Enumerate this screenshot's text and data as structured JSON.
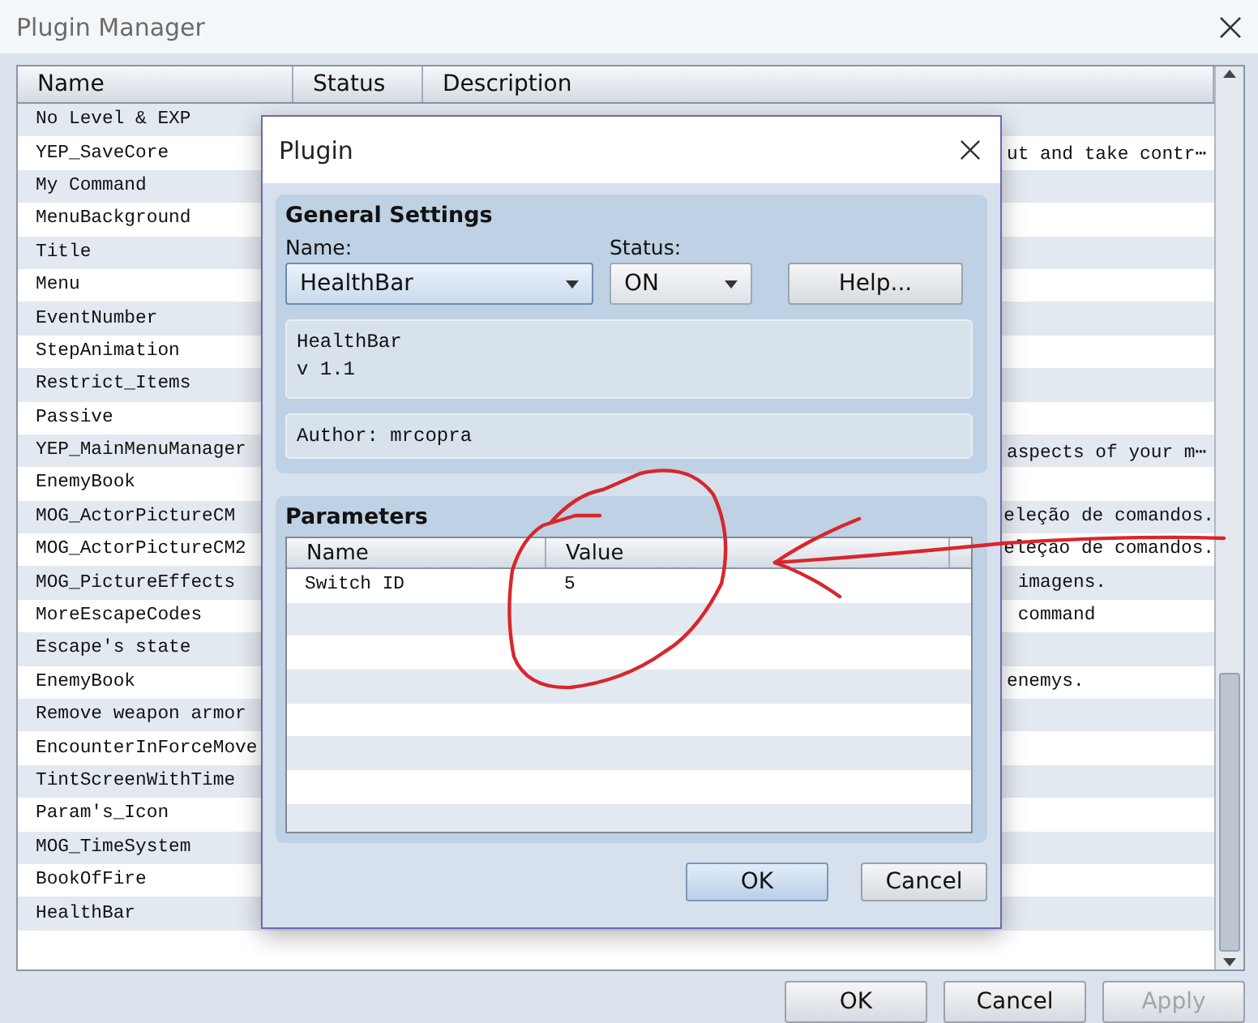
{
  "window": {
    "title": "Plugin Manager"
  },
  "plugin_table": {
    "columns": [
      "Name",
      "Status",
      "Description"
    ],
    "rows": [
      {
        "name": "No Level & EXP"
      },
      {
        "name": "YEP_SaveCore",
        "description": "ut and take contr⋯"
      },
      {
        "name": "My Command"
      },
      {
        "name": "MenuBackground"
      },
      {
        "name": "Title"
      },
      {
        "name": "Menu"
      },
      {
        "name": "EventNumber"
      },
      {
        "name": "StepAnimation"
      },
      {
        "name": "Restrict_Items"
      },
      {
        "name": "Passive"
      },
      {
        "name": "YEP_MainMenuManager",
        "description": "aspects of your m⋯"
      },
      {
        "name": "EnemyBook"
      },
      {
        "name": "MOG_ActorPictureCM",
        "description": "eleção de comandos."
      },
      {
        "name": "MOG_ActorPictureCM2",
        "description": "eleção de comandos."
      },
      {
        "name": "MOG_PictureEffects",
        "description": " imagens."
      },
      {
        "name": "MoreEscapeCodes",
        "description": " command"
      },
      {
        "name": "Escape's state"
      },
      {
        "name": "EnemyBook",
        "description": "enemys."
      },
      {
        "name": "Remove weapon armor"
      },
      {
        "name": "EncounterInForceMove"
      },
      {
        "name": "TintScreenWithTime"
      },
      {
        "name": "Param's_Icon"
      },
      {
        "name": "MOG_TimeSystem"
      },
      {
        "name": "BookOfFire"
      },
      {
        "name": "HealthBar"
      }
    ]
  },
  "buttons": [
    {
      "label": "OK",
      "disabled": false
    },
    {
      "label": "Cancel",
      "disabled": false
    },
    {
      "label": "Apply",
      "disabled": true
    }
  ],
  "dialog": {
    "title": "Plugin",
    "general_settings": {
      "title": "General Settings",
      "name_label": "Name:",
      "name_value": "HealthBar",
      "status_label": "Status:",
      "status_value": "ON",
      "help_button": "Help...",
      "info_lines": [
        "HealthBar",
        "v 1.1"
      ],
      "author": "Author: mrcopra"
    },
    "parameters": {
      "title": "Parameters",
      "columns": [
        "Name",
        "Value"
      ],
      "rows": [
        {
          "name": "Switch ID",
          "value": "5"
        }
      ]
    },
    "buttons": [
      {
        "label": "OK",
        "default": true
      },
      {
        "label": "Cancel",
        "default": false
      }
    ]
  }
}
